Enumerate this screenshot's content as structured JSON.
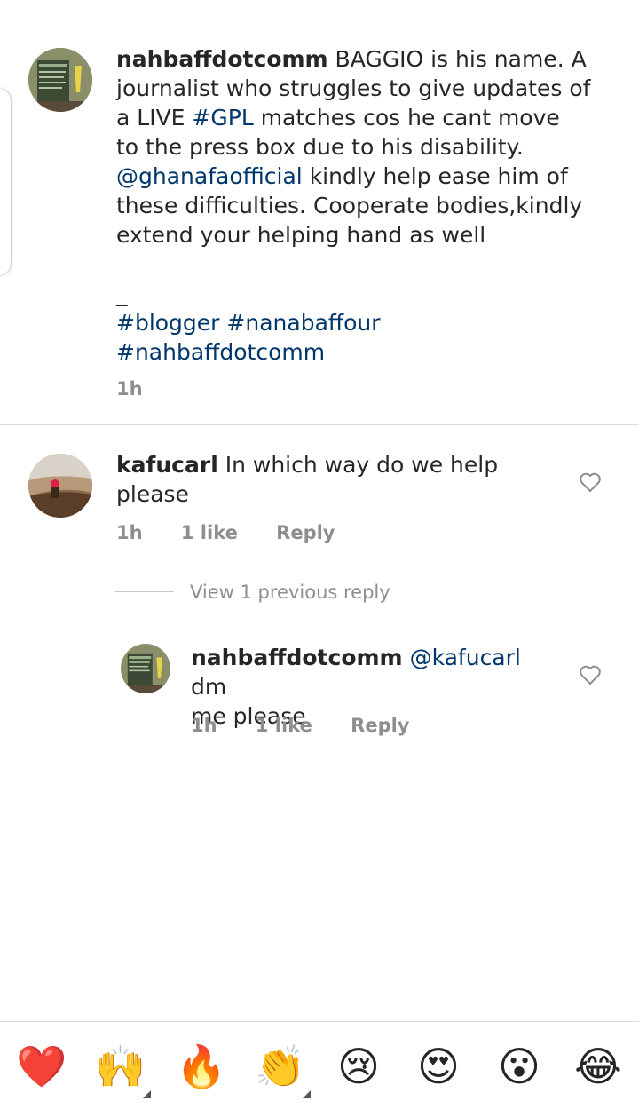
{
  "post": {
    "username": "nahbaffdotcomm",
    "caption_lines": [
      " BAGGIO is his name. A",
      "journalist who struggles to give updates of",
      "a LIVE ",
      " matches cos he cant move",
      "to the press box due to his disability.",
      " kindly help ease him of",
      "these difficulties. Cooperate bodies,kindly",
      "extend your helping hand as well",
      "_"
    ],
    "hashtag_gpl": "#GPL",
    "mention_ghanafa": "@ghanafaofficial",
    "tags_line1_a": "#blogger",
    "tags_line1_b": "#nanabaffour",
    "tags_line2": "#nahbaffdotcomm",
    "time": "1h"
  },
  "comment1": {
    "username": "kafucarl",
    "text_line1": " In which way do we help",
    "text_line2": "please",
    "time": "1h",
    "likes": "1 like",
    "reply": "Reply"
  },
  "view_replies": "View 1 previous reply",
  "reply1": {
    "username": "nahbaffdotcomm",
    "mention": "@kafucarl",
    "text_line1_tail": " dm",
    "text_line2": "me please",
    "time": "1h",
    "likes": "1 like",
    "reply": "Reply"
  },
  "emoji_bar": {
    "items": [
      "❤️",
      "🙌",
      "🔥",
      "👏",
      "😢",
      "😍",
      "😮",
      "😂"
    ],
    "names": [
      "red-heart",
      "raising-hands",
      "fire",
      "clapping-hands",
      "crying-face",
      "heart-eyes",
      "surprised-face",
      "tears-of-joy"
    ]
  },
  "colors": {
    "link": "#00376b",
    "meta": "#8e8e8e",
    "text": "#262626",
    "divider": "#dbdbdb"
  }
}
